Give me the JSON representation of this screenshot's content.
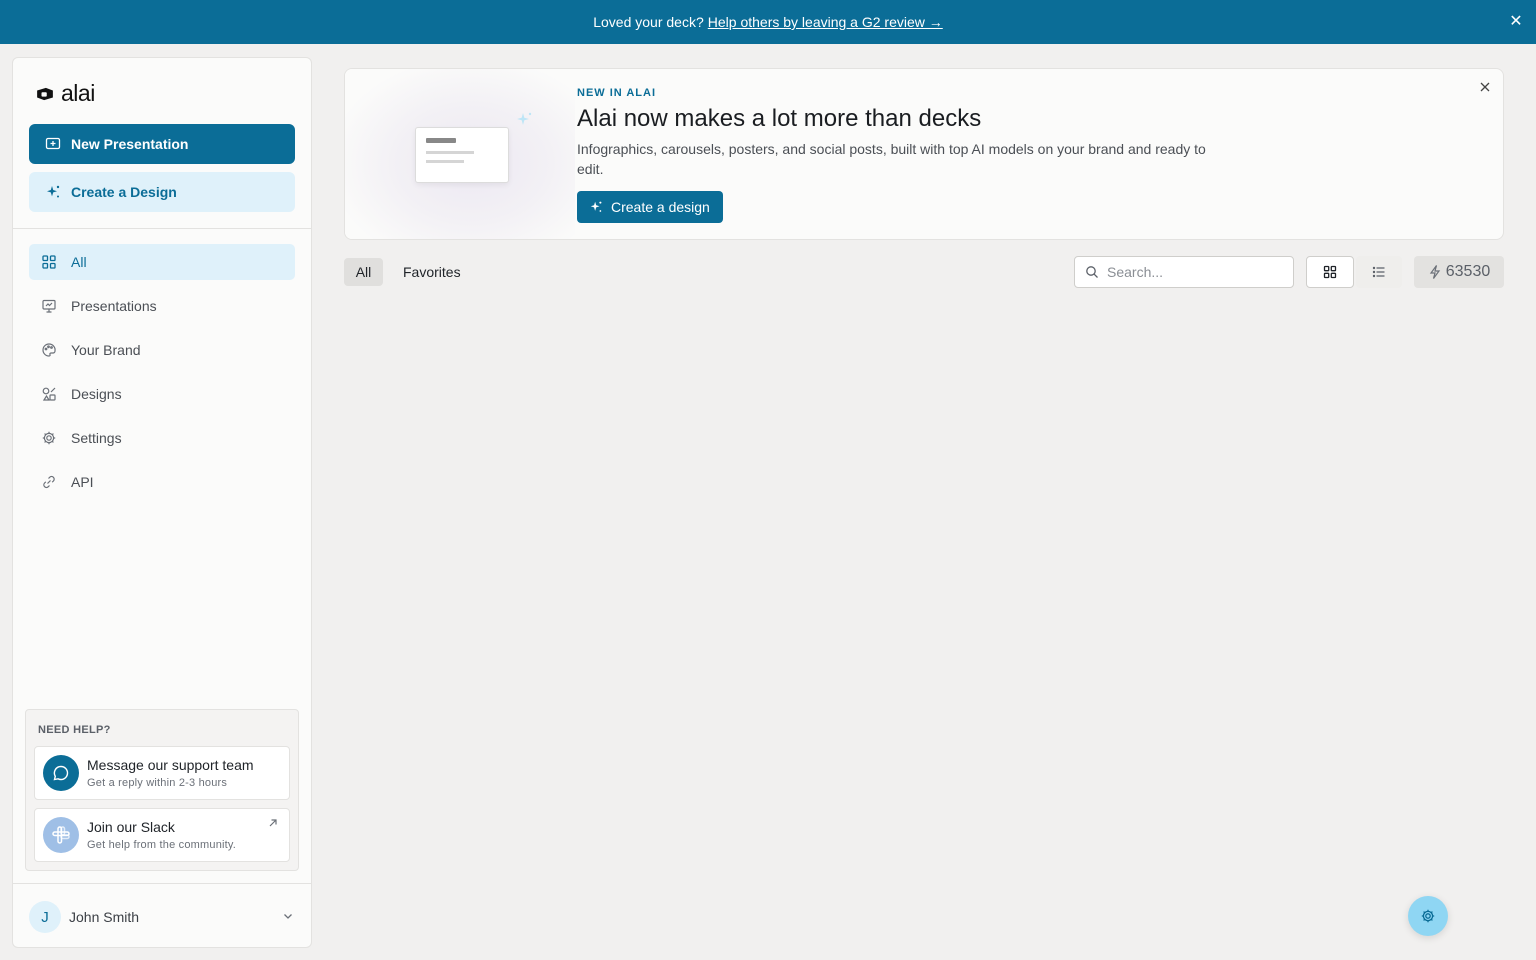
{
  "banner": {
    "text": "Loved your deck?",
    "link": "Help others by leaving a G2 review →",
    "close": "✕"
  },
  "sidebar": {
    "brand": "alai",
    "new_presentation": "New Presentation",
    "create_design": "Create a Design",
    "nav": [
      {
        "label": "All",
        "icon": "grid-icon",
        "active": true
      },
      {
        "label": "Presentations",
        "icon": "presentation-icon"
      },
      {
        "label": "Your Brand",
        "icon": "palette-icon"
      },
      {
        "label": "Designs",
        "icon": "shapes-icon"
      },
      {
        "label": "Settings",
        "icon": "gear-icon"
      },
      {
        "label": "API",
        "icon": "link-icon"
      }
    ],
    "help": {
      "title": "NEED HELP?",
      "support_title": "Message our support team",
      "support_sub": "Get a reply within 2-3 hours",
      "slack_title": "Join our Slack",
      "slack_sub": "Get help from the community."
    },
    "user": {
      "initial": "J",
      "name": "John Smith"
    }
  },
  "promo": {
    "eyebrow": "NEW IN ALAI",
    "heading": "Alai now makes a lot more than decks",
    "description": "Infographics, carousels, posters, and social posts, built with top AI models on your brand and ready to edit.",
    "cta": "Create a design"
  },
  "toolbar": {
    "filters": [
      "All",
      "Favorites"
    ],
    "search_placeholder": "Search...",
    "credits": "63530"
  },
  "colors": {
    "accent": "#0b6d97",
    "accent_light": "#dff1fa",
    "fab": "#8fd6f3"
  }
}
